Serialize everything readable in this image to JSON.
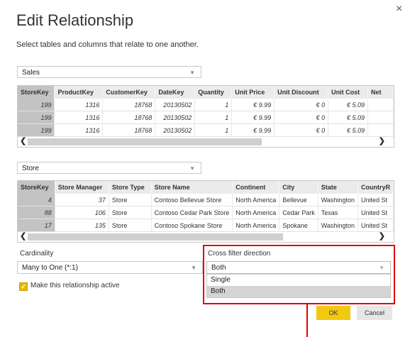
{
  "dialog": {
    "title": "Edit Relationship",
    "subtitle": "Select tables and columns that relate to one another.",
    "close_glyph": "×"
  },
  "table1": {
    "name": "Sales",
    "columns": [
      "StoreKey",
      "ProductKey",
      "CustomerKey",
      "DateKey",
      "Quantity",
      "Unit Price",
      "Unit Discount",
      "Unit Cost",
      "Net"
    ],
    "rows": [
      [
        "199",
        "1316",
        "18768",
        "20130502",
        "1",
        "€ 9.99",
        "€ 0",
        "€ 5.09",
        ""
      ],
      [
        "199",
        "1316",
        "18768",
        "20130502",
        "1",
        "€ 9.99",
        "€ 0",
        "€ 5.09",
        ""
      ],
      [
        "199",
        "1316",
        "18768",
        "20130502",
        "1",
        "€ 9.99",
        "€ 0",
        "€ 5.09",
        ""
      ]
    ]
  },
  "table2": {
    "name": "Store",
    "columns": [
      "StoreKey",
      "Store Manager",
      "Store Type",
      "Store Name",
      "Continent",
      "City",
      "State",
      "CountryR"
    ],
    "rows": [
      [
        "4",
        "37",
        "Store",
        "Contoso Bellevue Store",
        "North America",
        "Bellevue",
        "Washington",
        "United St"
      ],
      [
        "88",
        "106",
        "Store",
        "Contoso Cedar Park Store",
        "North America",
        "Cedar Park",
        "Texas",
        "United St"
      ],
      [
        "17",
        "135",
        "Store",
        "Contoso Spokane Store",
        "North America",
        "Spokane",
        "Washington",
        "United St"
      ]
    ]
  },
  "cardinality": {
    "label": "Cardinality",
    "value": "Many to One (*:1)"
  },
  "active_checkbox": {
    "label": "Make this relationship active",
    "checked": true
  },
  "cross_filter": {
    "label": "Cross filter direction",
    "value": "Both",
    "options": [
      "Single",
      "Both"
    ]
  },
  "buttons": {
    "ok": "OK",
    "cancel": "Cancel"
  },
  "colors": {
    "accent": "#f2c811",
    "highlight": "#e00000",
    "selected_column": "#c3c3c3"
  }
}
